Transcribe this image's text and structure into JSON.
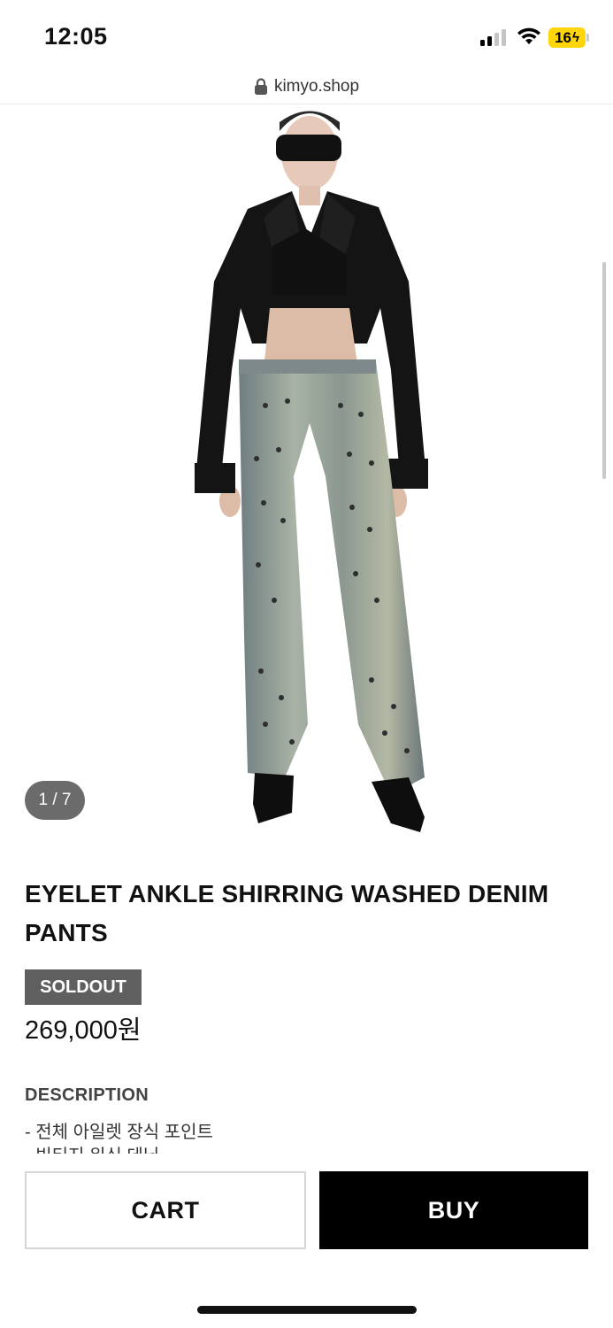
{
  "status_bar": {
    "time": "12:05",
    "battery_level": "16",
    "battery_color": "#ffd60a",
    "icons": [
      "cellular-signal-icon",
      "wifi-icon",
      "battery-charging-icon"
    ]
  },
  "url_bar": {
    "url": "kimyo.shop",
    "icon": "lock-icon"
  },
  "gallery": {
    "page_indicator": "1 / 7",
    "image": "model wearing eyelet washed denim pants"
  },
  "product": {
    "title": "EYELET ANKLE SHIRRING WASHED DENIM PANTS",
    "badge": "SOLDOUT",
    "price": "269,000원",
    "description_heading": "DESCRIPTION",
    "description_lines": [
      "- 전체 아일렛 장식 포인트",
      "- 빈티지 워싱 데님"
    ]
  },
  "actions": {
    "cart_label": "CART",
    "buy_label": "BUY"
  },
  "colors": {
    "buy_background": "#000000",
    "badge_background": "#5f5f5f",
    "page_indicator_background": "#6b6b6b"
  }
}
